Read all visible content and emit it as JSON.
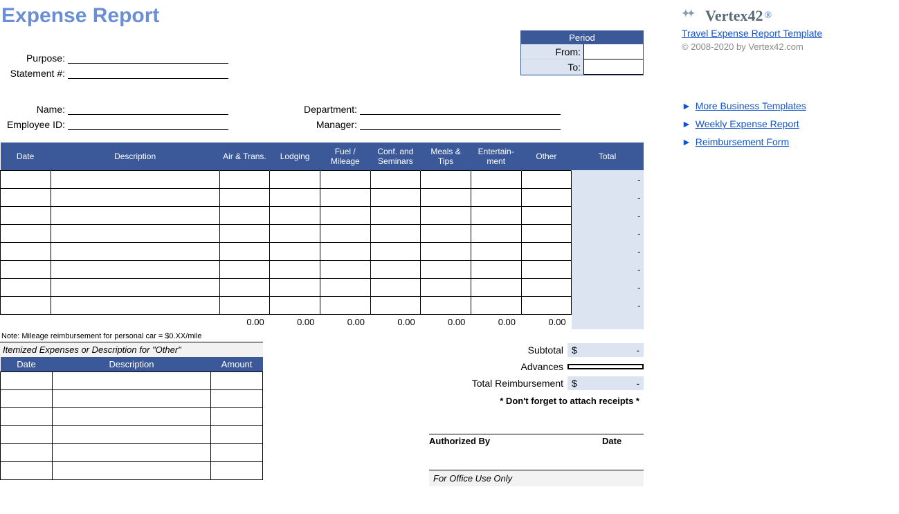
{
  "title": "Expense Report",
  "fields": {
    "purpose_label": "Purpose:",
    "statement_label": "Statement #:",
    "name_label": "Name:",
    "employee_id_label": "Employee ID:",
    "department_label": "Department:",
    "manager_label": "Manager:"
  },
  "period": {
    "header": "Period",
    "from_label": "From:",
    "to_label": "To:"
  },
  "expense_headers": {
    "date": "Date",
    "description": "Description",
    "air": "Air & Trans.",
    "lodging": "Lodging",
    "fuel": "Fuel / Mileage",
    "conf": "Conf. and Seminars",
    "meals": "Meals & Tips",
    "entertain": "Entertain-ment",
    "other": "Other",
    "total": "Total"
  },
  "row_total_placeholder": "-",
  "column_totals": {
    "air": "0.00",
    "lodging": "0.00",
    "fuel": "0.00",
    "conf": "0.00",
    "meals": "0.00",
    "entertain": "0.00",
    "other": "0.00"
  },
  "note": "Note: Mileage reimbursement for personal car = $0.XX/mile",
  "itemized": {
    "title": "Itemized Expenses or Description for \"Other\"",
    "date": "Date",
    "description": "Description",
    "amount": "Amount"
  },
  "summary": {
    "subtotal_label": "Subtotal",
    "subtotal_currency": "$",
    "subtotal_value": "-",
    "advances_label": "Advances",
    "total_label": "Total Reimbursement",
    "total_currency": "$",
    "total_value": "-",
    "receipts": "* Don't forget to attach receipts *"
  },
  "auth": {
    "by": "Authorized By",
    "date": "Date",
    "office": "For Office Use Only"
  },
  "sidebar": {
    "logo_text": "Vertex42",
    "template_link": "Travel Expense Report Template",
    "copyright": "© 2008-2020 by Vertex42.com",
    "links": {
      "0": "More Business Templates",
      "1": "Weekly Expense Report",
      "2": "Reimbursement Form"
    }
  }
}
